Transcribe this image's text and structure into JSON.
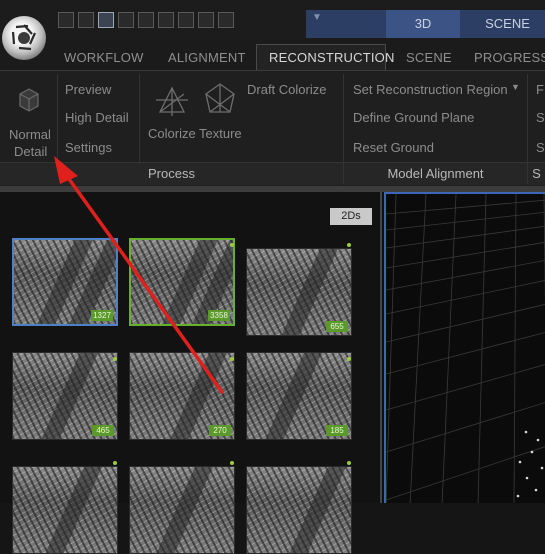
{
  "title_tabs": {
    "view_3d": "3D",
    "scene": "SCENE"
  },
  "ribbon_tabs": [
    {
      "label": "WORKFLOW"
    },
    {
      "label": "ALIGNMENT"
    },
    {
      "label": "RECONSTRUCTION",
      "active": true
    },
    {
      "label": "SCENE"
    },
    {
      "label": "PROGRESS"
    }
  ],
  "process_group": {
    "normal_detail": [
      "Normal",
      "Detail"
    ],
    "preview": "Preview",
    "high_detail": "High Detail",
    "settings": "Settings",
    "colorize": "Colorize",
    "texture": "Texture",
    "draft_colorize": "Draft Colorize",
    "label": "Process"
  },
  "model_alignment_group": {
    "set_region": "Set Reconstruction Region",
    "define_ground": "Define Ground Plane",
    "reset_ground": "Reset Ground",
    "label": "Model Alignment"
  },
  "truncated_group": {
    "letters": [
      "F",
      "S",
      "S",
      "S"
    ]
  },
  "images_panel": {
    "badge": "2Ds",
    "thumbnails": [
      {
        "count": "1327",
        "selected": "blue"
      },
      {
        "count": "3358",
        "selected": "green"
      },
      {
        "count": "655"
      },
      {
        "count": "465"
      },
      {
        "count": "270"
      },
      {
        "count": "185"
      },
      {
        "count": ""
      },
      {
        "count": ""
      },
      {
        "count": ""
      }
    ]
  },
  "colors": {
    "accent_blue": "#3e66b8",
    "title_blue": "#2c3e63",
    "selection_green": "#66b030",
    "annotation_red": "#e0201c"
  }
}
